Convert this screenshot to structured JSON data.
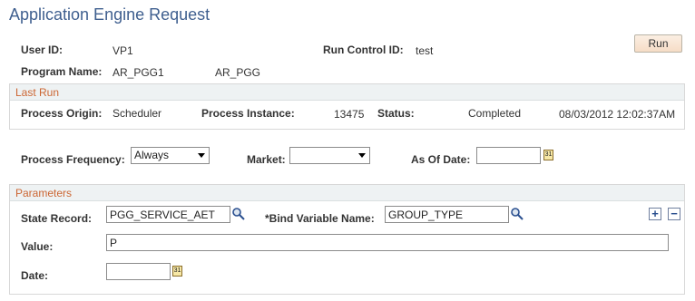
{
  "page": {
    "title": "Application Engine Request"
  },
  "header": {
    "user_id_label": "User ID:",
    "user_id_value": "VP1",
    "run_control_label": "Run Control ID:",
    "run_control_value": "test",
    "run_button": "Run",
    "program_name_label": "Program Name:",
    "program_name_value": "AR_PGG1",
    "program_desc": "AR_PGG"
  },
  "last_run": {
    "title": "Last Run",
    "process_origin_label": "Process Origin:",
    "process_origin_value": "Scheduler",
    "process_instance_label": "Process Instance:",
    "process_instance_value": "13475",
    "status_label": "Status:",
    "status_value": "Completed",
    "timestamp": "08/03/2012 12:02:37AM"
  },
  "options": {
    "process_frequency_label": "Process Frequency:",
    "process_frequency_value": "Always",
    "market_label": "Market:",
    "market_value": "",
    "as_of_date_label": "As Of Date:",
    "as_of_date_value": ""
  },
  "parameters": {
    "title": "Parameters",
    "state_record_label": "State Record:",
    "state_record_value": "PGG_SERVICE_AET",
    "bind_variable_label": "*Bind Variable Name:",
    "bind_variable_value": "GROUP_TYPE",
    "value_label": "Value:",
    "value_value": "P",
    "date_label": "Date:",
    "date_value": ""
  },
  "icons": {
    "calendar": "calendar-icon",
    "lookup": "magnifier-icon",
    "add": "plus-icon",
    "delete": "minus-icon"
  }
}
